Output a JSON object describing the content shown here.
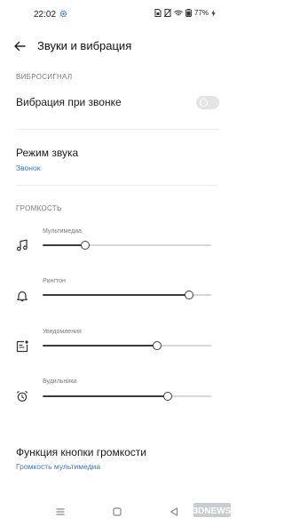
{
  "status_bar": {
    "time": "22:02",
    "battery": "77%"
  },
  "header": {
    "title": "Звуки и вибрация"
  },
  "vibration_section": {
    "label": "ВИБРОСИГНАЛ",
    "ring_vibration_label": "Вибрация при звонке",
    "ring_vibration_on": false
  },
  "sound_mode": {
    "title": "Режим звука",
    "value": "Звонок"
  },
  "volume_section": {
    "label": "ГРОМКОСТЬ",
    "sliders": [
      {
        "label": "Мультимедиа",
        "level": 0.25,
        "icon": "music-note-icon"
      },
      {
        "label": "Рингтон",
        "level": 0.87,
        "icon": "bell-icon"
      },
      {
        "label": "Уведомления",
        "level": 0.68,
        "icon": "notification-icon"
      },
      {
        "label": "Будильники",
        "level": 0.74,
        "icon": "alarm-clock-icon"
      }
    ]
  },
  "volume_button": {
    "title": "Функция кнопки громкости",
    "value": "Громкость мультимедиа"
  },
  "watermark": "3DNEWS",
  "colors": {
    "accent": "#3a76c7",
    "slider": "#3b3b3b",
    "track": "#d8d8d8"
  }
}
